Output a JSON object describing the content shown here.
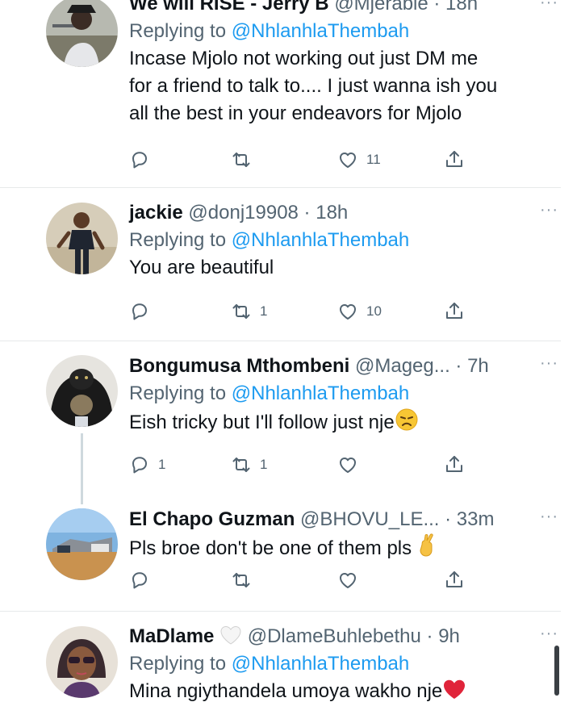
{
  "replying_label": "Replying to",
  "more_label": "···",
  "icons": {
    "reply": "reply-icon",
    "retweet": "retweet-icon",
    "like": "like-icon",
    "share": "share-icon"
  },
  "colors": {
    "link": "#1d9bf0",
    "secondary": "#536471",
    "heart": "#e0243a",
    "divider": "#e7e9ea"
  },
  "tweets": [
    {
      "display_name": "We will RISE - Jerry B",
      "handle": "@Mjerable",
      "time": "18h",
      "replying_to": "@NhlanhlaThembah",
      "text_lines": [
        "Incase Mjolo not working out just DM me",
        "for a friend to talk to.... I just wanna ish you",
        "all the best in your endeavors for Mjolo"
      ],
      "replies": "",
      "retweets": "",
      "likes": "11"
    },
    {
      "display_name": "jackie",
      "handle": "@donj19908",
      "time": "18h",
      "replying_to": "@NhlanhlaThembah",
      "text": "You are beautiful",
      "replies": "",
      "retweets": "1",
      "likes": "10"
    },
    {
      "display_name": "Bongumusa Mthombeni",
      "handle": "@Mageg...",
      "time": "7h",
      "replying_to": "@NhlanhlaThembah",
      "text": "Eish tricky  but I'll follow just nje",
      "emoji": "disappointed-face-emoji",
      "replies": "1",
      "retweets": "1",
      "likes": ""
    },
    {
      "display_name": "El Chapo Guzman",
      "handle": "@BHOVU_LE...",
      "time": "33m",
      "text": "Pls broe don't be one of them pls",
      "emoji": "crossed-fingers-emoji",
      "replies": "",
      "retweets": "",
      "likes": ""
    },
    {
      "display_name": "MaDlame",
      "name_emoji": "white-heart-emoji",
      "handle": "@DlameBuhlebethu",
      "time": "9h",
      "replying_to": "@NhlanhlaThembah",
      "text": "Mina ngiythandela umoya wakho nje",
      "emoji": "red-heart-emoji"
    }
  ]
}
